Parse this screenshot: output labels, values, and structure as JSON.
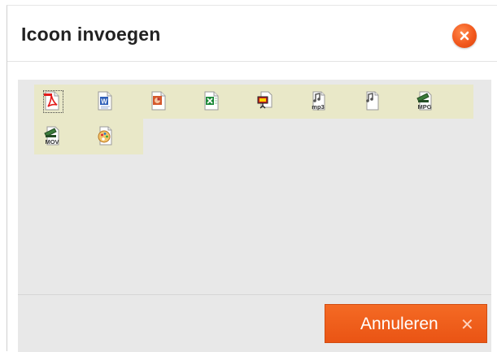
{
  "dialog": {
    "title": "Icoon invoegen",
    "close_icon": "close-icon",
    "cancel_label": "Annuleren",
    "cancel_icon_glyph": "✕"
  },
  "icons": [
    {
      "name": "pdf-file-icon",
      "color": "#e31b1b"
    },
    {
      "name": "word-file-icon",
      "color": "#2f5fb8"
    },
    {
      "name": "powerpoint-file-icon",
      "color": "#d5582b"
    },
    {
      "name": "excel-file-icon",
      "color": "#1e8a3a"
    },
    {
      "name": "presentation-file-icon",
      "color": "#c02020"
    },
    {
      "name": "mp3-file-icon",
      "color": "#555555",
      "badge": "mp3"
    },
    {
      "name": "audio-file-icon",
      "color": "#555555"
    },
    {
      "name": "mpg-file-icon",
      "color": "#3b7b3b",
      "badge": "MPG"
    },
    {
      "name": "mov-file-icon",
      "color": "#3b7b3b",
      "badge": "MOV"
    },
    {
      "name": "image-file-icon",
      "color": "#d9822b"
    }
  ],
  "colors": {
    "accent": "#ea5414",
    "grid_highlight": "#e9e8c8",
    "panel": "#e8e8e8"
  }
}
